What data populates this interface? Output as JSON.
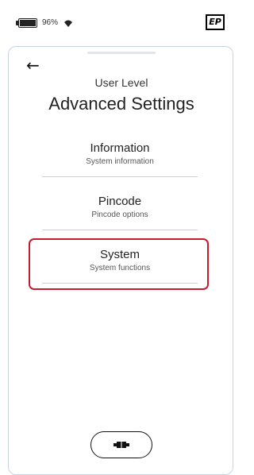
{
  "status_bar": {
    "battery_percent": "96%",
    "battery_level": 0.96,
    "logo_text": "EP"
  },
  "header": {
    "back_icon": "←",
    "subtitle": "User Level",
    "title": "Advanced Settings"
  },
  "menu": {
    "items": [
      {
        "label": "Information",
        "description": "System information"
      },
      {
        "label": "Pincode",
        "description": "Pincode options"
      },
      {
        "label": "System",
        "description": "System functions",
        "selected": true
      }
    ]
  },
  "bottom": {
    "button_icon": "connector-icon"
  },
  "colors": {
    "accent": "#c61b2c",
    "sheet_border": "#c9d4e6",
    "text": "#222222"
  }
}
